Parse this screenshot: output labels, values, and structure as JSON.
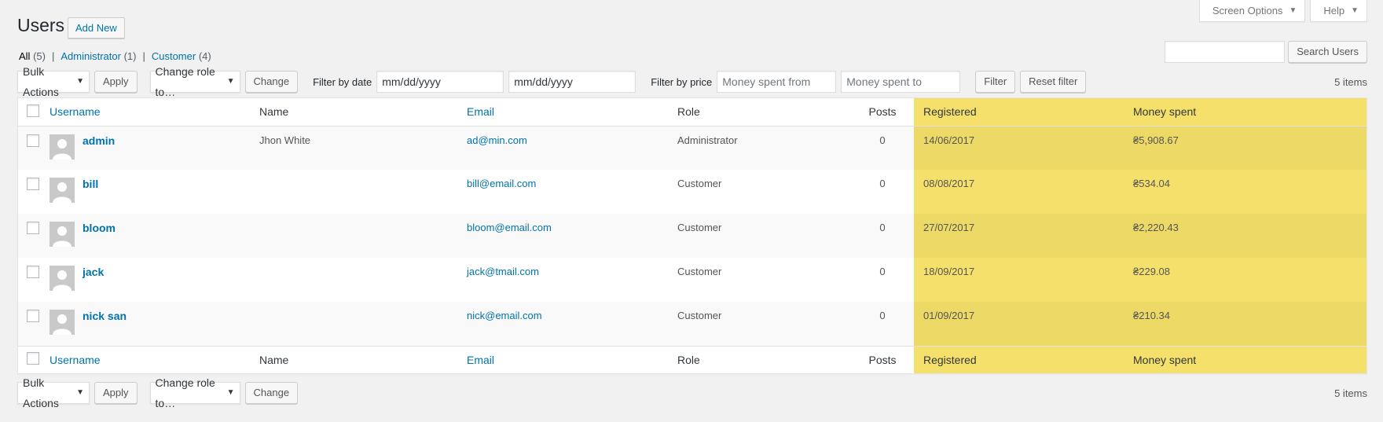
{
  "header": {
    "title": "Users",
    "add_new": "Add New"
  },
  "screen_meta": {
    "screen_options": "Screen Options",
    "help": "Help"
  },
  "views": {
    "all_label": "All",
    "all_count": "(5)",
    "admin_label": "Administrator",
    "admin_count": "(1)",
    "customer_label": "Customer",
    "customer_count": "(4)",
    "separator": "|"
  },
  "search": {
    "value": "",
    "button": "Search Users"
  },
  "tablenav": {
    "bulk_actions": "Bulk Actions",
    "apply": "Apply",
    "change_role": "Change role to…",
    "change": "Change",
    "filter_by_date": "Filter by date",
    "date_from_placeholder": "mm/dd/yyyy",
    "date_to_placeholder": "mm/dd/yyyy",
    "filter_by_price": "Filter by price",
    "money_from_placeholder": "Money spent from",
    "money_to_placeholder": "Money spent to",
    "filter": "Filter",
    "reset_filter": "Reset filter",
    "items_count": "5 items"
  },
  "columns": {
    "username": "Username",
    "name": "Name",
    "email": "Email",
    "role": "Role",
    "posts": "Posts",
    "registered": "Registered",
    "money_spent": "Money spent"
  },
  "rows": [
    {
      "username": "admin",
      "name": "Jhon White",
      "email": "ad@min.com",
      "role": "Administrator",
      "posts": "0",
      "registered": "14/06/2017",
      "money_spent": "₴5,908.67"
    },
    {
      "username": "bill",
      "name": "",
      "email": "bill@email.com",
      "role": "Customer",
      "posts": "0",
      "registered": "08/08/2017",
      "money_spent": "₴534.04"
    },
    {
      "username": "bloom",
      "name": "",
      "email": "bloom@email.com",
      "role": "Customer",
      "posts": "0",
      "registered": "27/07/2017",
      "money_spent": "₴2,220.43"
    },
    {
      "username": "jack",
      "name": "",
      "email": "jack@tmail.com",
      "role": "Customer",
      "posts": "0",
      "registered": "18/09/2017",
      "money_spent": "₴229.08"
    },
    {
      "username": "nick san",
      "name": "",
      "email": "nick@email.com",
      "role": "Customer",
      "posts": "0",
      "registered": "01/09/2017",
      "money_spent": "₴210.34"
    }
  ],
  "colors": {
    "link": "#0073aa",
    "highlight": "#f4e06a",
    "background": "#f1f1f1"
  }
}
